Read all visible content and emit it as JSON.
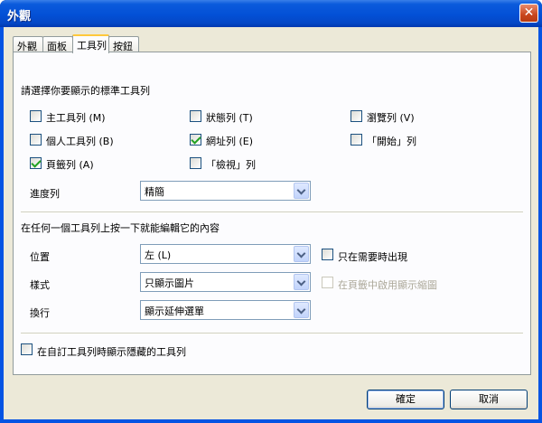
{
  "window": {
    "title": "外觀",
    "close_icon": "close-icon"
  },
  "tabs": [
    {
      "label": "外觀"
    },
    {
      "label": "面板"
    },
    {
      "label": "工具列"
    },
    {
      "label": "按鈕"
    }
  ],
  "toolbars_section": {
    "heading": "請選擇你要顯示的標準工具列",
    "checkboxes": [
      {
        "label": "主工具列 (M)",
        "checked": false
      },
      {
        "label": "狀態列 (T)",
        "checked": false
      },
      {
        "label": "瀏覽列 (V)",
        "checked": false
      },
      {
        "label": "個人工具列 (B)",
        "checked": false
      },
      {
        "label": "網址列 (E)",
        "checked": true
      },
      {
        "label": "「開始」列",
        "checked": false
      },
      {
        "label": "頁籤列 (A)",
        "checked": true
      },
      {
        "label": "「檢視」列",
        "checked": false
      }
    ],
    "progress_label": "進度列",
    "progress_value": "精簡"
  },
  "edit_section": {
    "heading": "在任何一個工具列上按一下就能編輯它的內容",
    "position_label": "位置",
    "position_value": "左 (L)",
    "show_when_needed": {
      "label": "只在需要時出現",
      "checked": false
    },
    "style_label": "樣式",
    "style_value": "只顯示圖片",
    "tab_thumbnails": {
      "label": "在頁籤中啟用顯示縮圖",
      "checked": false,
      "disabled": true
    },
    "wrap_label": "換行",
    "wrap_value": "顯示延伸選單"
  },
  "show_hidden": {
    "label": "在自訂工具列時顯示隱藏的工具列",
    "checked": false
  },
  "buttons": {
    "ok": "確定",
    "cancel": "取消"
  }
}
